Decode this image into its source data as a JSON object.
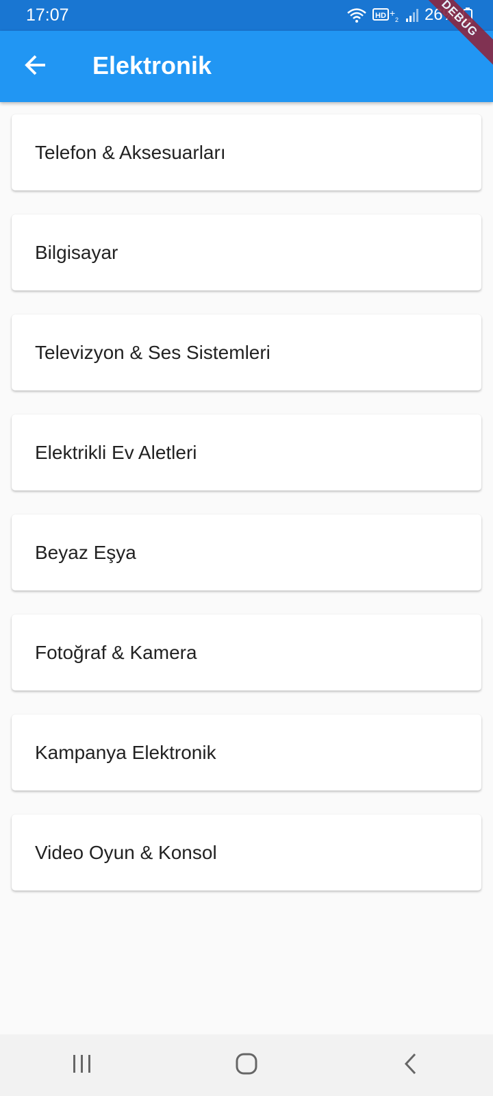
{
  "status_bar": {
    "time": "17:07",
    "battery": "26%",
    "icons": [
      "wifi-icon",
      "hd-voice-icon",
      "signal-icon",
      "battery-icon"
    ]
  },
  "debug_banner": "DEBUG",
  "app_bar": {
    "title": "Elektronik",
    "back_icon": "arrow-back-icon",
    "background": "#2196f3"
  },
  "categories": [
    {
      "label": "Telefon & Aksesuarları"
    },
    {
      "label": "Bilgisayar"
    },
    {
      "label": "Televizyon & Ses Sistemleri"
    },
    {
      "label": "Elektrikli Ev Aletleri"
    },
    {
      "label": "Beyaz Eşya"
    },
    {
      "label": "Fotoğraf & Kamera"
    },
    {
      "label": "Kampanya Elektronik"
    },
    {
      "label": "Video Oyun & Konsol"
    }
  ],
  "nav_bar": {
    "buttons": [
      "recent-apps-icon",
      "home-icon",
      "back-nav-icon"
    ]
  }
}
